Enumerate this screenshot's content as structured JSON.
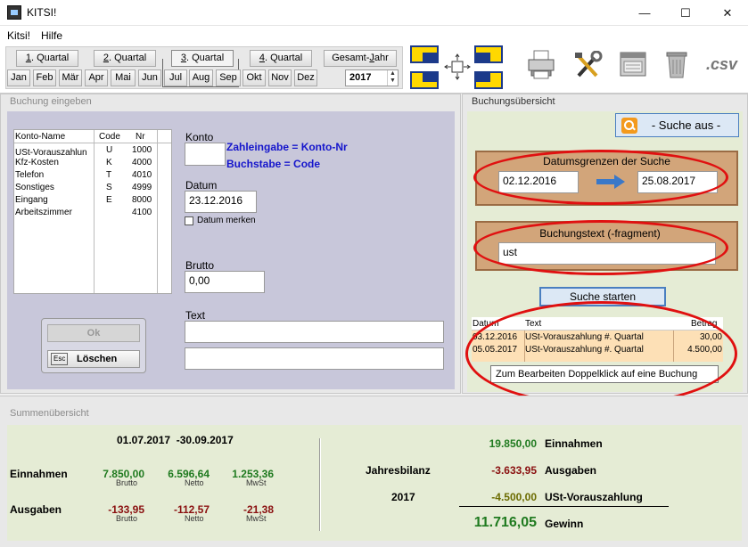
{
  "window": {
    "title": "KITSI!",
    "minimize": "—",
    "maximize": "☐",
    "close": "✕"
  },
  "menu": [
    "Kitsi!",
    "Hilfe"
  ],
  "quarters": [
    {
      "prefix": "1",
      "suffix": ". Quartal"
    },
    {
      "prefix": "2",
      "suffix": ". Quartal"
    },
    {
      "prefix": "3",
      "suffix": ". Quartal"
    },
    {
      "prefix": "4",
      "suffix": ". Quartal"
    }
  ],
  "gesamt": {
    "pre": "Gesamt-",
    "u": "J",
    "post": "ahr"
  },
  "months": [
    "Jan",
    "Feb",
    "Mär",
    "Apr",
    "Mai",
    "Jun",
    "Jul",
    "Aug",
    "Sep",
    "Okt",
    "Nov",
    "Dez"
  ],
  "year": "2017",
  "toolbar_icons": [
    "layout-icon",
    "arrange-icon",
    "print-icon",
    "tools-icon",
    "archive-icon",
    "trash-icon"
  ],
  "csv_label": ".csv",
  "entry": {
    "section_title": "Buchung eingeben",
    "table_headers": [
      "Konto-Name",
      "Code",
      "Nr"
    ],
    "accounts": [
      {
        "name": "USt-Vorauszahlun",
        "code": "U",
        "nr": "1000"
      },
      {
        "name": "Kfz-Kosten",
        "code": "K",
        "nr": "4000"
      },
      {
        "name": "Telefon",
        "code": "T",
        "nr": "4010"
      },
      {
        "name": "Sonstiges",
        "code": "S",
        "nr": "4999"
      },
      {
        "name": "Eingang",
        "code": "E",
        "nr": "8000"
      },
      {
        "name": "Arbeitszimmer",
        "code": "",
        "nr": "4100"
      }
    ],
    "konto_label": "Konto",
    "konto_value": "",
    "hint1": "Zahleingabe = Konto-Nr",
    "hint2": "Buchstabe = Code",
    "datum_label": "Datum",
    "datum_value": "23.12.2016",
    "datum_merken": "Datum merken",
    "brutto_label": "Brutto",
    "brutto_value": "0,00",
    "text_label": "Text",
    "text_value1": "",
    "text_value2": "",
    "ok_label": "Ok",
    "esc_label": "Esc",
    "delete_label": "Löschen"
  },
  "overview": {
    "section_title": "Buchungsübersicht",
    "search_toggle": "- Suche aus -",
    "date_range_label": "Datumsgrenzen der Suche",
    "date_from": "02.12.2016",
    "date_to": "25.08.2017",
    "text_label": "Buchungstext (-fragment)",
    "text_value": "ust",
    "start_button": "Suche starten",
    "result_headers": [
      "Datum",
      "Text",
      "Betrag"
    ],
    "results": [
      {
        "datum": "03.12.2016",
        "text": "USt-Vorauszahlung #. Quartal",
        "betrag": "30,00"
      },
      {
        "datum": "05.05.2017",
        "text": "USt-Vorauszahlung #. Quartal",
        "betrag": "4.500,00"
      }
    ],
    "tooltip": "Zum Bearbeiten Doppelklick auf eine Buchung",
    "highlight_color": "#e01010"
  },
  "summary": {
    "section_title": "Summenübersicht",
    "period": "01.07.2017  -30.09.2017",
    "einnahmen_label": "Einnahmen",
    "ausgaben_label": "Ausgaben",
    "sub_brutto": "Brutto",
    "sub_netto": "Netto",
    "sub_mwst": "MwSt",
    "einnahmen": {
      "brutto": "7.850,00",
      "netto": "6.596,64",
      "mwst": "1.253,36"
    },
    "ausgaben": {
      "brutto": "-133,95",
      "netto": "-112,57",
      "mwst": "-21,38"
    },
    "jahresbilanz_label": "Jahresbilanz",
    "jahr": "2017",
    "bilanz": [
      {
        "value": "19.850,00",
        "label": "Einnahmen"
      },
      {
        "value": "-3.633,95",
        "label": "Ausgaben"
      },
      {
        "value": "-4.500,00",
        "label": "USt-Vorauszahlung"
      }
    ],
    "gewinn_value": "11.716,05",
    "gewinn_label": "Gewinn"
  }
}
